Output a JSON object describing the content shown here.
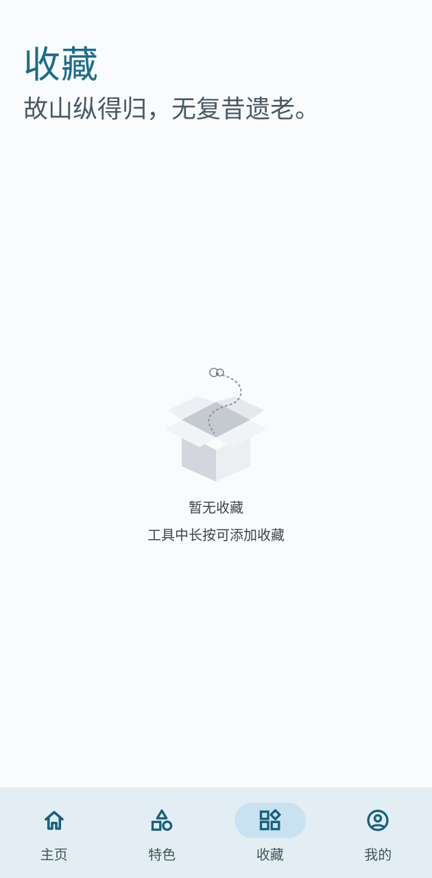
{
  "header": {
    "title": "收藏",
    "subtitle": "故山纵得归，无复昔遗老。"
  },
  "empty_state": {
    "icon": "open-box-icon",
    "title": "暂无收藏",
    "hint": "工具中长按可添加收藏"
  },
  "bottom_nav": {
    "items": [
      {
        "label": "主页",
        "icon": "home-icon",
        "active": false
      },
      {
        "label": "特色",
        "icon": "shapes-icon",
        "active": false
      },
      {
        "label": "收藏",
        "icon": "widgets-icon",
        "active": true
      },
      {
        "label": "我的",
        "icon": "account-circle-icon",
        "active": false
      }
    ]
  },
  "colors": {
    "accent": "#1b6d8c",
    "nav_background": "#e3eef4",
    "nav_active_pill": "#c9e2f1",
    "page_background": "#fafbfd"
  }
}
